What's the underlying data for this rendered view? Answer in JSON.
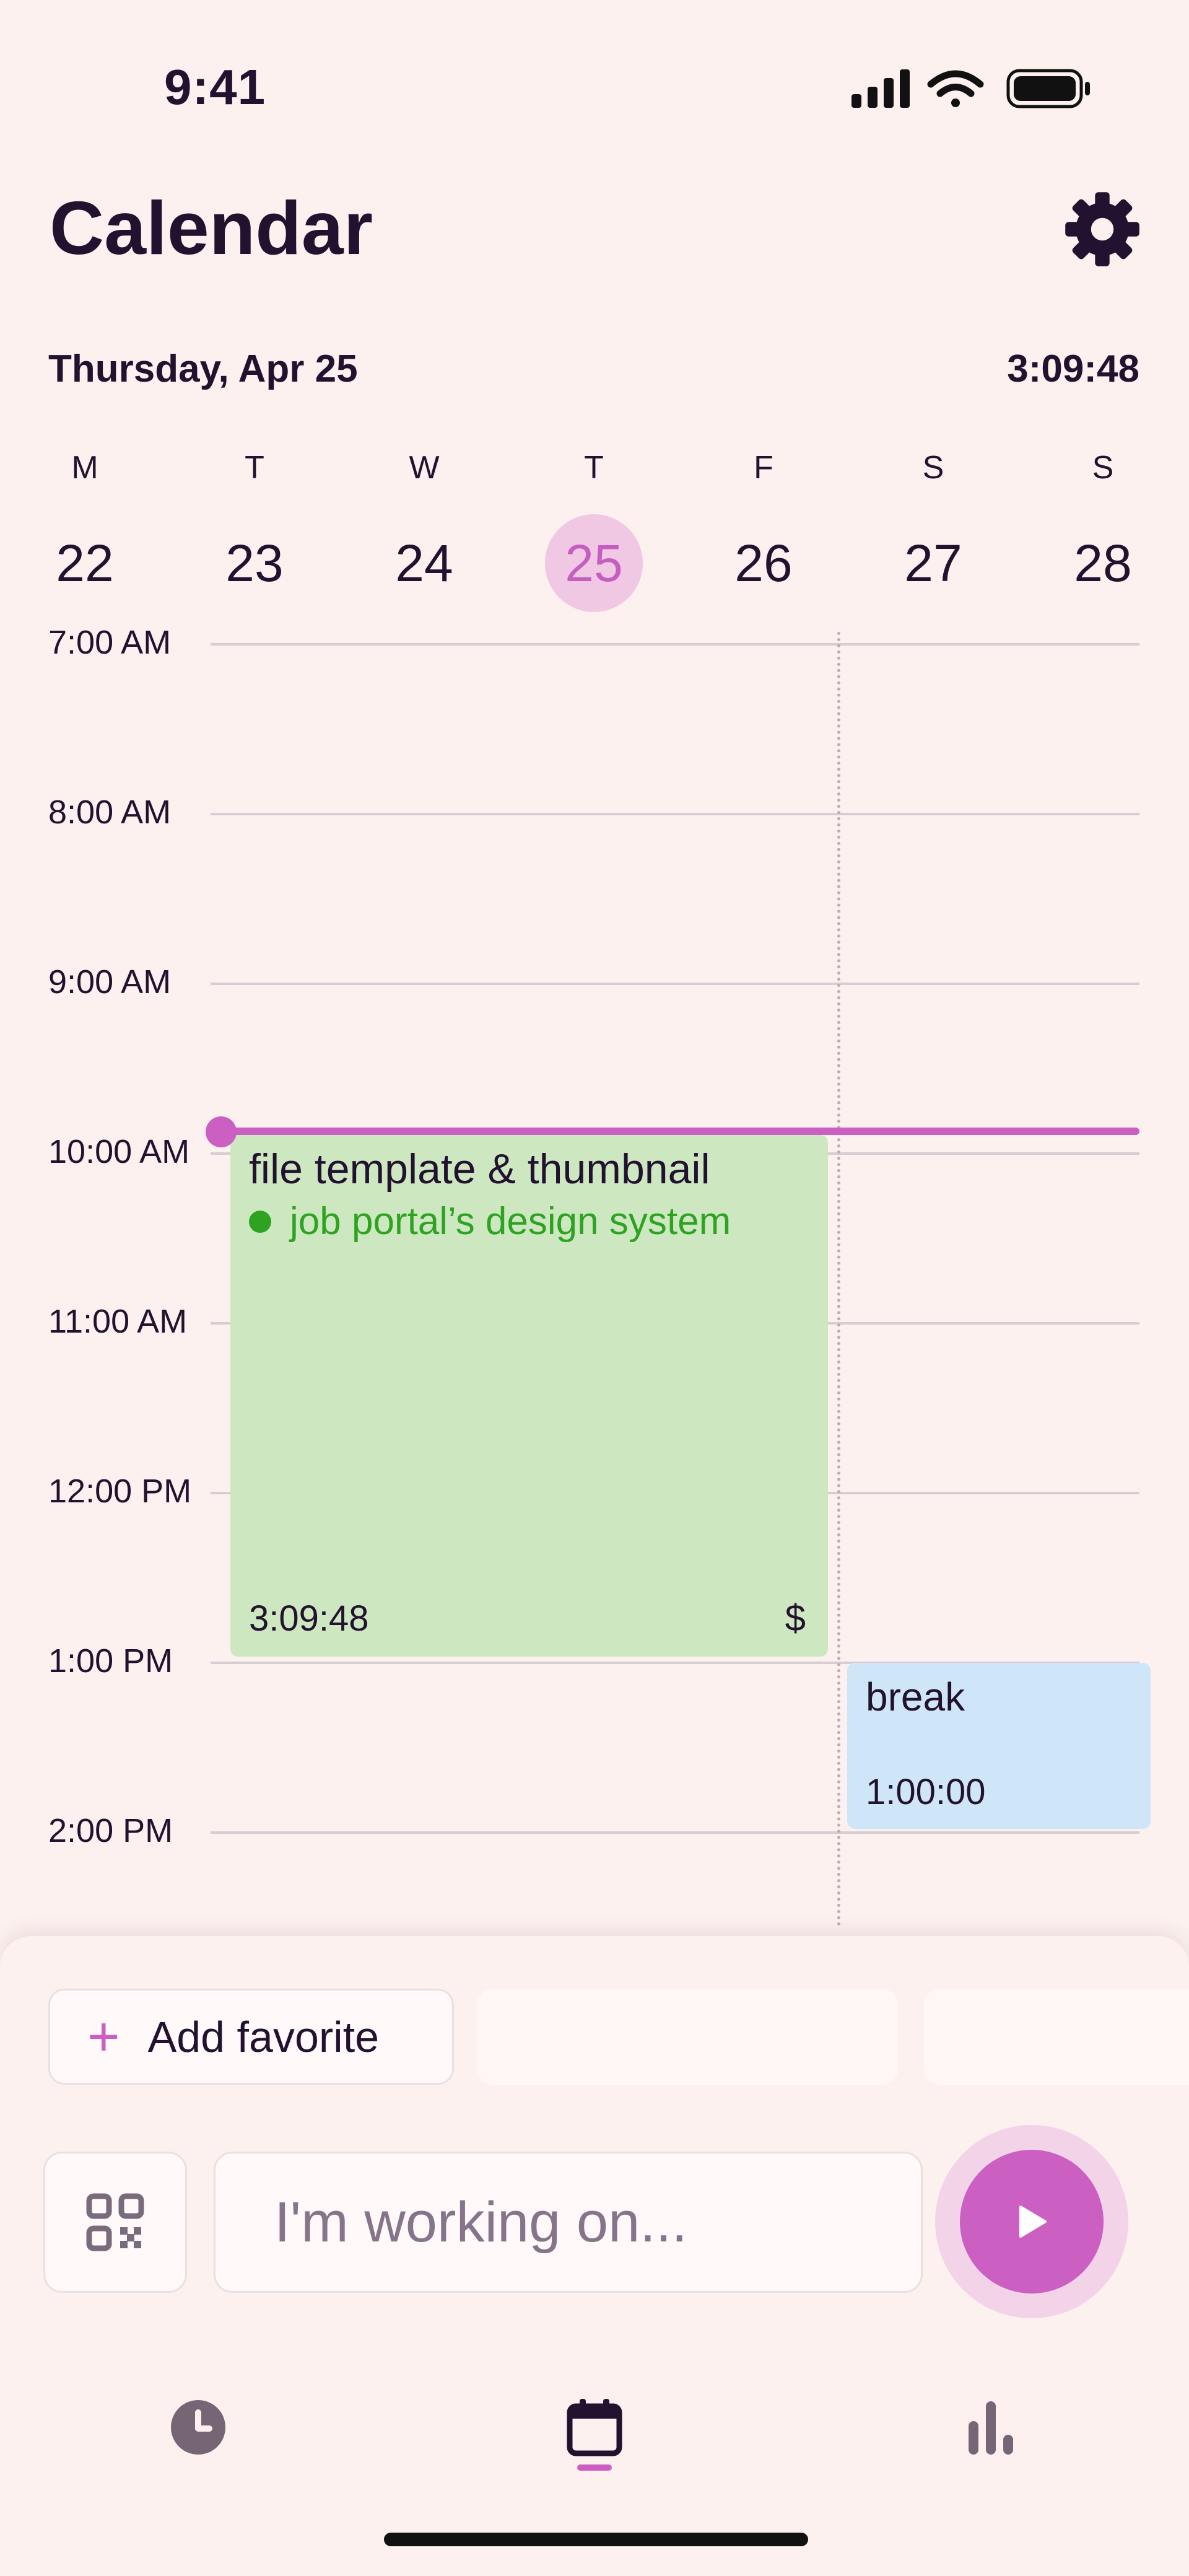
{
  "status_bar": {
    "time": "9:41"
  },
  "header": {
    "title": "Calendar"
  },
  "date_row": {
    "date": "Thursday, Apr 25",
    "clock": "3:09:48"
  },
  "week": [
    {
      "letter": "M",
      "num": "22",
      "today": false
    },
    {
      "letter": "T",
      "num": "23",
      "today": false
    },
    {
      "letter": "W",
      "num": "24",
      "today": false
    },
    {
      "letter": "T",
      "num": "25",
      "today": true
    },
    {
      "letter": "F",
      "num": "26",
      "today": false
    },
    {
      "letter": "S",
      "num": "27",
      "today": false
    },
    {
      "letter": "S",
      "num": "28",
      "today": false
    }
  ],
  "hours": [
    "7:00 AM",
    "8:00 AM",
    "9:00 AM",
    "10:00 AM",
    "11:00 AM",
    "12:00 PM",
    "1:00 PM",
    "2:00 PM"
  ],
  "events": {
    "work": {
      "title": "file template & thumbnail",
      "project": "job portal’s design system",
      "duration": "3:09:48",
      "billable": "$"
    },
    "break": {
      "title": "break",
      "duration": "1:00:00"
    }
  },
  "favorites": {
    "add_label": "Add favorite"
  },
  "entry": {
    "placeholder": "I'm working on..."
  },
  "colors": {
    "accent": "#cc5fc2",
    "work_event": "#cde8c1",
    "project_green": "#2ea321",
    "break_event": "#cfe6f8",
    "background": "#fcf1ef"
  },
  "tabs": [
    {
      "icon": "clock-icon",
      "active": false
    },
    {
      "icon": "calendar-icon",
      "active": true
    },
    {
      "icon": "bar-chart-icon",
      "active": false
    }
  ]
}
